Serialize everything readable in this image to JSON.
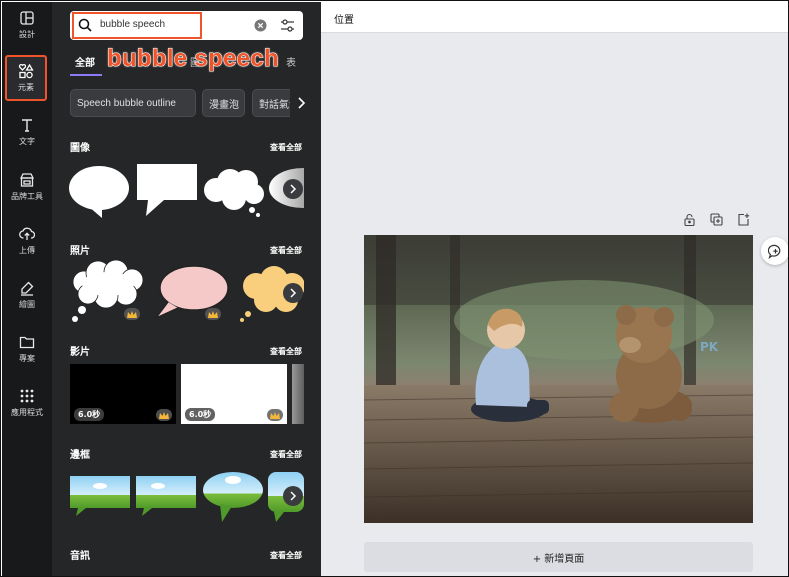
{
  "nav": {
    "items": [
      {
        "label": "設計",
        "icon": "layout-icon"
      },
      {
        "label": "元素",
        "icon": "shapes-icon"
      },
      {
        "label": "文字",
        "icon": "text-icon"
      },
      {
        "label": "品牌工具",
        "icon": "brand-icon"
      },
      {
        "label": "上傳",
        "icon": "upload-icon"
      },
      {
        "label": "繪圖",
        "icon": "draw-icon"
      },
      {
        "label": "專案",
        "icon": "folder-icon"
      },
      {
        "label": "應用程式",
        "icon": "apps-icon"
      }
    ]
  },
  "search": {
    "value": "bubble speech",
    "icon": "search-icon",
    "clear_icon": "clear-icon",
    "filter_icon": "filter-icon"
  },
  "callout": "bubble speech",
  "tabs": [
    {
      "label": "全部"
    },
    {
      "label": "圖"
    },
    {
      "label": "表"
    }
  ],
  "chips": [
    {
      "label": "Speech bubble outline"
    },
    {
      "label": "漫畫泡"
    },
    {
      "label": "對話氣泡"
    }
  ],
  "sections": {
    "graphics": {
      "title": "圖像",
      "see_all": "查看全部"
    },
    "photos": {
      "title": "照片",
      "see_all": "查看全部"
    },
    "videos": {
      "title": "影片",
      "see_all": "查看全部",
      "items": [
        {
          "duration": "6.0秒"
        },
        {
          "duration": "6.0秒"
        }
      ]
    },
    "frames": {
      "title": "邊框",
      "see_all": "查看全部"
    },
    "audio": {
      "title": "音訊",
      "see_all": "查看全部"
    }
  },
  "topbar": {
    "position_label": "位置"
  },
  "photo": {
    "watermark": "PK"
  },
  "add_page": "+ 新增頁面",
  "colors": {
    "highlight": "#f0542b",
    "panel": "#252627",
    "nav": "#18191b",
    "accent": "#8b7bf5"
  }
}
